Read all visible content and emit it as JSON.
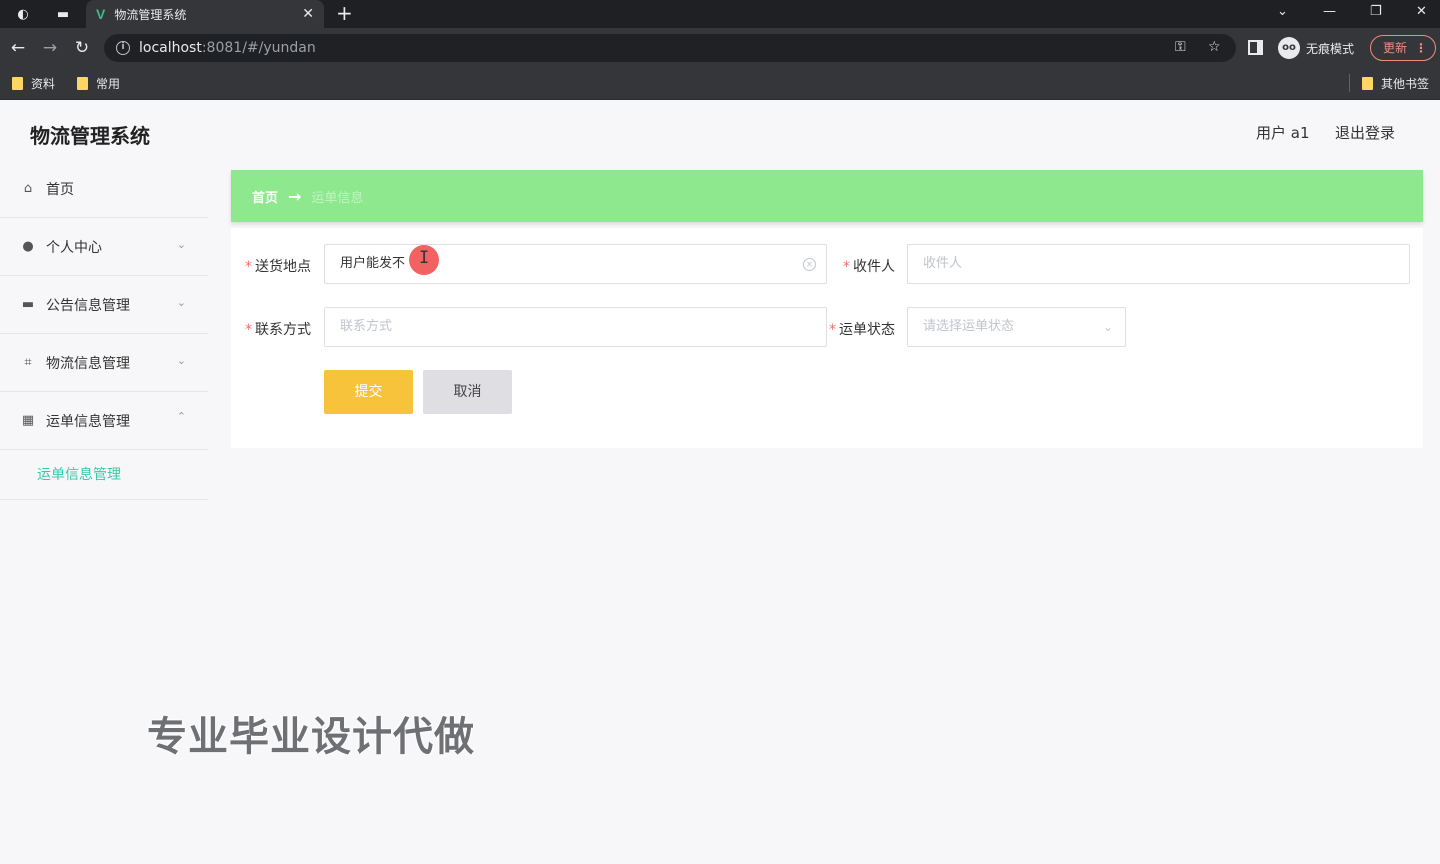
{
  "browser": {
    "tab_title": "物流管理系统",
    "url_host": "localhost",
    "url_rest": ":8081/#/yundan",
    "incognito_label": "无痕模式",
    "update_label": "更新",
    "bookmarks": [
      "资料",
      "常用"
    ],
    "other_bookmarks": "其他书签"
  },
  "header": {
    "title": "物流管理系统",
    "user": "用户 a1",
    "logout": "退出登录"
  },
  "sidebar": {
    "items": [
      {
        "label": "首页",
        "icon": "home-icon"
      },
      {
        "label": "个人中心",
        "icon": "user-icon"
      },
      {
        "label": "公告信息管理",
        "icon": "notice-icon"
      },
      {
        "label": "物流信息管理",
        "icon": "crop-icon"
      },
      {
        "label": "运单信息管理",
        "icon": "grid-icon"
      }
    ],
    "sub_item": "运单信息管理"
  },
  "breadcrumb": {
    "home": "首页",
    "current": "运单信息"
  },
  "form": {
    "address_label": "送货地点",
    "address_value": "用户能发不",
    "receiver_label": "收件人",
    "receiver_placeholder": "收件人",
    "contact_label": "联系方式",
    "contact_placeholder": "联系方式",
    "status_label": "运单状态",
    "status_placeholder": "请选择运单状态",
    "submit": "提交",
    "cancel": "取消"
  },
  "watermark": "专业毕业设计代做",
  "colors": {
    "breadcrumb_bg": "#8ee98e",
    "submit_bg": "#f7c33a",
    "active_submenu": "#38c9a9",
    "required": "#f56c6c"
  }
}
